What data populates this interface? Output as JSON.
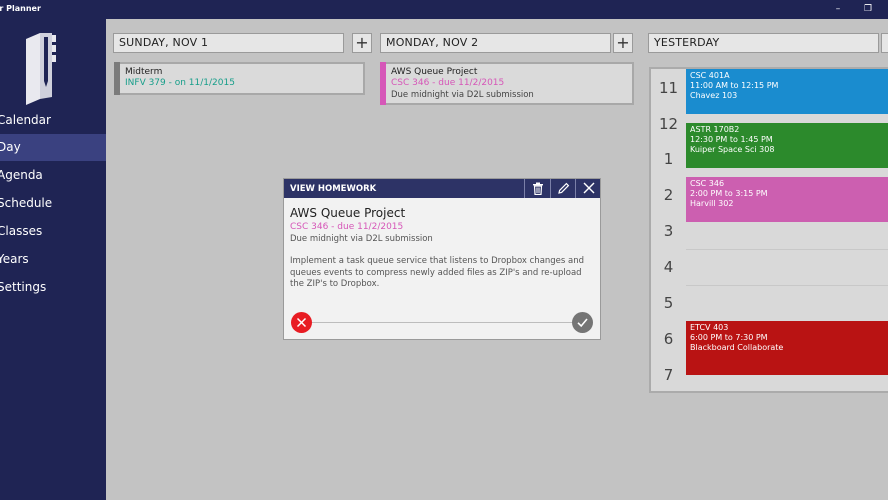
{
  "window": {
    "title": "er Planner"
  },
  "sidebar": {
    "items": [
      {
        "label": "Calendar",
        "active": false
      },
      {
        "label": "Day",
        "active": true
      },
      {
        "label": "Agenda",
        "active": false
      },
      {
        "label": "Schedule",
        "active": false
      },
      {
        "label": "Classes",
        "active": false
      },
      {
        "label": "Years",
        "active": false
      },
      {
        "label": "Settings",
        "active": false
      }
    ]
  },
  "days": [
    {
      "label": "SUNDAY, NOV 1",
      "homework": {
        "title": "Midterm",
        "course": "INFV 379 - on 11/1/2015",
        "course_color": "#179e8a",
        "bar_color": "#7b7b7b"
      }
    },
    {
      "label": "MONDAY, NOV 2",
      "homework": {
        "title": "AWS Queue Project",
        "course": "CSC 346 - due 11/2/2015",
        "note": "Due midnight via D2L submission",
        "course_color": "#d657b8",
        "bar_color": "#d657b8"
      }
    },
    {
      "label": "YESTERDAY"
    }
  ],
  "schedule": {
    "hours": [
      "11",
      "12",
      "1",
      "2",
      "3",
      "4",
      "5",
      "6",
      "7"
    ],
    "events": [
      {
        "title": "CSC 401A",
        "time": "11:00 AM to 12:15 PM",
        "location": "Chavez 103",
        "color": "#1a8ccf"
      },
      {
        "title": "ASTR 170B2",
        "time": "12:30 PM to 1:45 PM",
        "location": "Kuiper Space Sci 308",
        "color": "#2c8a2c"
      },
      {
        "title": "CSC 346",
        "time": "2:00 PM to 3:15 PM",
        "location": "Harvill 302",
        "color": "#cc5fb0"
      },
      {
        "title": "ETCV 403",
        "time": "6:00 PM to 7:30 PM",
        "location": "Blackboard Collaborate",
        "color": "#b91313"
      }
    ]
  },
  "view_homework": {
    "header": "VIEW HOMEWORK",
    "title": "AWS Queue Project",
    "course": "CSC 346 - due 11/2/2015",
    "due_note": "Due midnight via D2L submission",
    "description": "Implement a task queue service that listens to Dropbox changes and queues events to compress newly added files as ZIP's and re-upload the ZIP's to Dropbox.",
    "icons": [
      "delete-icon",
      "edit-icon",
      "close-icon",
      "cancel-icon",
      "complete-icon"
    ]
  }
}
